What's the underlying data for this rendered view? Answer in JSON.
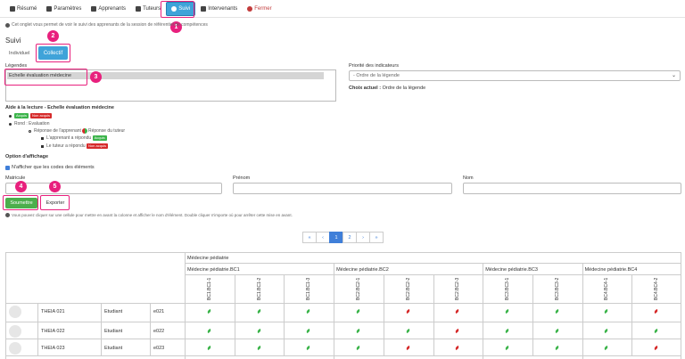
{
  "nav": {
    "tabs": [
      {
        "label": "Résumé",
        "icon": "dashboard-icon"
      },
      {
        "label": "Paramètres",
        "icon": "edit-icon"
      },
      {
        "label": "Apprenants",
        "icon": "user-icon"
      },
      {
        "label": "Tuteurs",
        "icon": "user-icon"
      },
      {
        "label": "Suivi",
        "icon": "info-icon"
      },
      {
        "label": "Intervenants",
        "icon": "user-icon"
      },
      {
        "label": "Fermer",
        "icon": "close-icon"
      }
    ],
    "active": "Suivi"
  },
  "info_text": "Cet onglet vous permet de voir le suivi des apprenants de la session de référentiel de compétences",
  "section_title": "Suivi",
  "toggle": {
    "individual_label": "Individuel",
    "collective_label": "Collectif"
  },
  "legendes": {
    "label": "Légendes",
    "selected": "Echelle évaluation médecine"
  },
  "priorite": {
    "label": "Priorité des indicateurs",
    "placeholder": "- Ordre de la légende",
    "choix_label": "Choix actuel :",
    "choix_value": "Ordre de la légende"
  },
  "aide": {
    "title": "Aide à la lecture - Echelle évaluation médecine",
    "acquis": "Acquis",
    "non_acquis": "Non acquis",
    "rond_label": "Rond : Evaluation",
    "reponse_apprenant": "Réponse de l'apprenant",
    "reponse_tuteur": "Réponse du tuteur",
    "apprenant_repondu": "L'apprenant a répondu",
    "tuteur_repondu": "Le tuteur a répondu"
  },
  "options": {
    "title": "Option d'affichage",
    "checkbox_label": "N'afficher que les codes des éléments"
  },
  "filters": {
    "matricule": "Matricule",
    "prenom": "Prénom",
    "nom": "Nom"
  },
  "buttons": {
    "submit": "Soumettre",
    "export": "Exporter"
  },
  "info_text2": "Vous pouvez cliquer sur une cellule pour mettre en avant la colonne et afficher le nom d'élément. Double cliquer n'importe où pour arrêter cette mise en avant.",
  "pagination": {
    "pages": [
      "1",
      "2"
    ],
    "current": "1"
  },
  "annotations": [
    "1",
    "2",
    "3",
    "4",
    "5"
  ],
  "table": {
    "group": "Médecine pédiatrie",
    "blocks": [
      "Médecine pédiatrie.BC1",
      "Médecine pédiatrie.BC2",
      "Médecine pédiatrie.BC3",
      "Médecine pédiatrie.BC4"
    ],
    "columns": [
      "BC1.BC1-1",
      "BC1.BC1-2",
      "BC1.BC1-3",
      "BC2.BC2-1",
      "BC2.BC2-2",
      "BC2.BC2-3",
      "BC3.BC3-1",
      "BC3.BC3-2",
      "BC4.BC4-1",
      "BC4.BC4-2"
    ],
    "rows": [
      {
        "name": "THEIA 021",
        "role": "Etudiant",
        "code": "e021",
        "marks": [
          "g",
          "g",
          "g",
          "g",
          "r",
          "r",
          "g",
          "g",
          "g",
          "r"
        ]
      },
      {
        "name": "THEIA 022",
        "role": "Etudiant",
        "code": "e022",
        "marks": [
          "g",
          "g",
          "g",
          "g",
          "g",
          "r",
          "g",
          "g",
          "g",
          "g"
        ]
      },
      {
        "name": "THEIA 023",
        "role": "Etudiant",
        "code": "e023",
        "marks": [
          "g",
          "g",
          "g",
          "g",
          "r",
          "r",
          "g",
          "g",
          "g",
          "r"
        ]
      }
    ]
  }
}
